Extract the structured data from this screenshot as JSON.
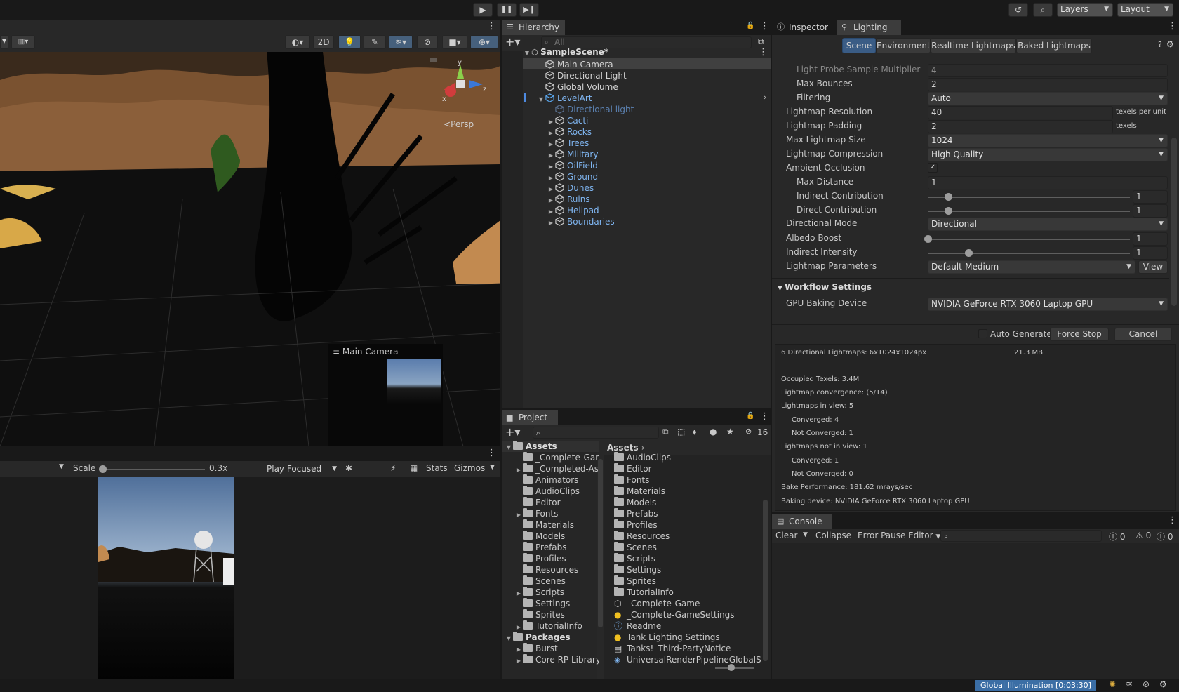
{
  "toolbar": {
    "layers_label": "Layers",
    "layout_label": "Layout"
  },
  "scene_view": {
    "toolbar_2d": "2D",
    "persp_label": "Persp",
    "axis_x": "x",
    "axis_y": "y",
    "axis_z": "z",
    "camera_preview_label": "Main Camera"
  },
  "game_view": {
    "scale_label": "Scale",
    "scale_value": "0.3x",
    "play_mode": "Play Focused",
    "stats_label": "Stats",
    "gizmos_label": "Gizmos"
  },
  "hierarchy": {
    "tab_label": "Hierarchy",
    "search_placeholder": "All",
    "scene_name": "SampleScene*",
    "items": [
      {
        "label": "Main Camera",
        "color": "#d2d2d2"
      },
      {
        "label": "Directional Light",
        "color": "#d2d2d2"
      },
      {
        "label": "Global Volume",
        "color": "#d2d2d2"
      },
      {
        "label": "LevelArt",
        "color": "#7fb5f0"
      },
      {
        "label": "Directional light",
        "color": "#5a7fae"
      },
      {
        "label": "Cacti",
        "color": "#7fb5f0"
      },
      {
        "label": "Rocks",
        "color": "#7fb5f0"
      },
      {
        "label": "Trees",
        "color": "#7fb5f0"
      },
      {
        "label": "Military",
        "color": "#7fb5f0"
      },
      {
        "label": "OilField",
        "color": "#7fb5f0"
      },
      {
        "label": "Ground",
        "color": "#7fb5f0"
      },
      {
        "label": "Dunes",
        "color": "#7fb5f0"
      },
      {
        "label": "Ruins",
        "color": "#7fb5f0"
      },
      {
        "label": "Helipad",
        "color": "#7fb5f0"
      },
      {
        "label": "Boundaries",
        "color": "#7fb5f0"
      }
    ]
  },
  "project": {
    "tab_label": "Project",
    "hidden_count": "16",
    "tree": [
      {
        "label": "Assets",
        "bold": true
      },
      {
        "label": "_Complete-Gar"
      },
      {
        "label": "_Completed-As"
      },
      {
        "label": "Animators"
      },
      {
        "label": "AudioClips"
      },
      {
        "label": "Editor"
      },
      {
        "label": "Fonts"
      },
      {
        "label": "Materials"
      },
      {
        "label": "Models"
      },
      {
        "label": "Prefabs"
      },
      {
        "label": "Profiles"
      },
      {
        "label": "Resources"
      },
      {
        "label": "Scenes"
      },
      {
        "label": "Scripts"
      },
      {
        "label": "Settings"
      },
      {
        "label": "Sprites"
      },
      {
        "label": "TutorialInfo"
      },
      {
        "label": "Packages",
        "bold": true
      },
      {
        "label": "Burst"
      },
      {
        "label": "Core RP Library"
      }
    ],
    "breadcrumb": "Assets",
    "files": [
      {
        "label": "AudioClips",
        "icon": "folder"
      },
      {
        "label": "Editor",
        "icon": "folder"
      },
      {
        "label": "Fonts",
        "icon": "folder"
      },
      {
        "label": "Materials",
        "icon": "folder"
      },
      {
        "label": "Models",
        "icon": "folder"
      },
      {
        "label": "Prefabs",
        "icon": "folder"
      },
      {
        "label": "Profiles",
        "icon": "folder"
      },
      {
        "label": "Resources",
        "icon": "folder"
      },
      {
        "label": "Scenes",
        "icon": "folder"
      },
      {
        "label": "Scripts",
        "icon": "folder"
      },
      {
        "label": "Settings",
        "icon": "folder"
      },
      {
        "label": "Sprites",
        "icon": "folder"
      },
      {
        "label": "TutorialInfo",
        "icon": "folder"
      },
      {
        "label": "_Complete-Game",
        "icon": "unity-scene"
      },
      {
        "label": "_Complete-GameSettings",
        "icon": "lighting-settings"
      },
      {
        "label": "Readme",
        "icon": "info"
      },
      {
        "label": "Tank Lighting Settings",
        "icon": "lighting-settings"
      },
      {
        "label": "Tanks!_Third-PartyNotice",
        "icon": "text-file"
      },
      {
        "label": "UniversalRenderPipelineGlobalSe",
        "icon": "render-asset"
      }
    ]
  },
  "lighting": {
    "tab_inspector": "Inspector",
    "tab_lighting": "Lighting",
    "subtabs": [
      "Scene",
      "Environment",
      "Realtime Lightmaps",
      "Baked Lightmaps"
    ],
    "rows": {
      "probe_mult_label": "Light Probe Sample Multiplier",
      "probe_mult_value": "4",
      "max_bounces_label": "Max Bounces",
      "max_bounces_value": "2",
      "filtering_label": "Filtering",
      "filtering_value": "Auto",
      "lm_res_label": "Lightmap Resolution",
      "lm_res_value": "40",
      "lm_res_unit": "texels per unit",
      "lm_pad_label": "Lightmap Padding",
      "lm_pad_value": "2",
      "lm_pad_unit": "texels",
      "max_size_label": "Max Lightmap Size",
      "max_size_value": "1024",
      "compression_label": "Lightmap Compression",
      "compression_value": "High Quality",
      "ao_label": "Ambient Occlusion",
      "max_dist_label": "Max Distance",
      "max_dist_value": "1",
      "indirect_contrib_label": "Indirect Contribution",
      "indirect_contrib_value": "1",
      "indirect_contrib_level": 0.1,
      "direct_contrib_label": "Direct Contribution",
      "direct_contrib_value": "1",
      "direct_contrib_level": 0.1,
      "dir_mode_label": "Directional Mode",
      "dir_mode_value": "Directional",
      "albedo_label": "Albedo Boost",
      "albedo_value": "1",
      "albedo_level": 0.0,
      "indirect_int_label": "Indirect Intensity",
      "indirect_int_value": "1",
      "indirect_int_level": 0.2,
      "lm_params_label": "Lightmap Parameters",
      "lm_params_value": "Default-Medium",
      "view_button": "View",
      "workflow_header": "Workflow Settings",
      "gpu_label": "GPU Baking Device",
      "gpu_value": "NVIDIA GeForce RTX 3060 Laptop GPU"
    },
    "auto_generate": "Auto Generate",
    "force_stop": "Force Stop",
    "cancel": "Cancel",
    "stats": {
      "lightmaps": "6 Directional Lightmaps: 6x1024x1024px",
      "size": "21.3 MB",
      "occupied": "Occupied Texels: 3.4M",
      "convergence": "Lightmap convergence: (5/14)",
      "in_view": "Lightmaps in view: 5",
      "in_view_converged": "Converged: 4",
      "in_view_not_converged": "Not Converged: 1",
      "not_in_view": "Lightmaps not in view: 1",
      "not_in_view_converged": "Converged: 1",
      "not_in_view_not_converged": "Not Converged: 0",
      "performance": "Bake Performance: 181.62 mrays/sec",
      "device": "Baking device: NVIDIA GeForce RTX 3060 Laptop GPU"
    }
  },
  "console": {
    "tab_label": "Console",
    "clear": "Clear",
    "collapse": "Collapse",
    "error_pause": "Error Pause",
    "editor": "Editor",
    "log_count": "0",
    "warn_count": "0",
    "error_count": "0"
  },
  "status_bar": {
    "gi_progress": "Global Illumination [0:03:30]"
  },
  "colors": {
    "accent": "#3b6ea5",
    "selected_tab": "#3a5c85",
    "prefab_blue": "#7fb5f0"
  }
}
